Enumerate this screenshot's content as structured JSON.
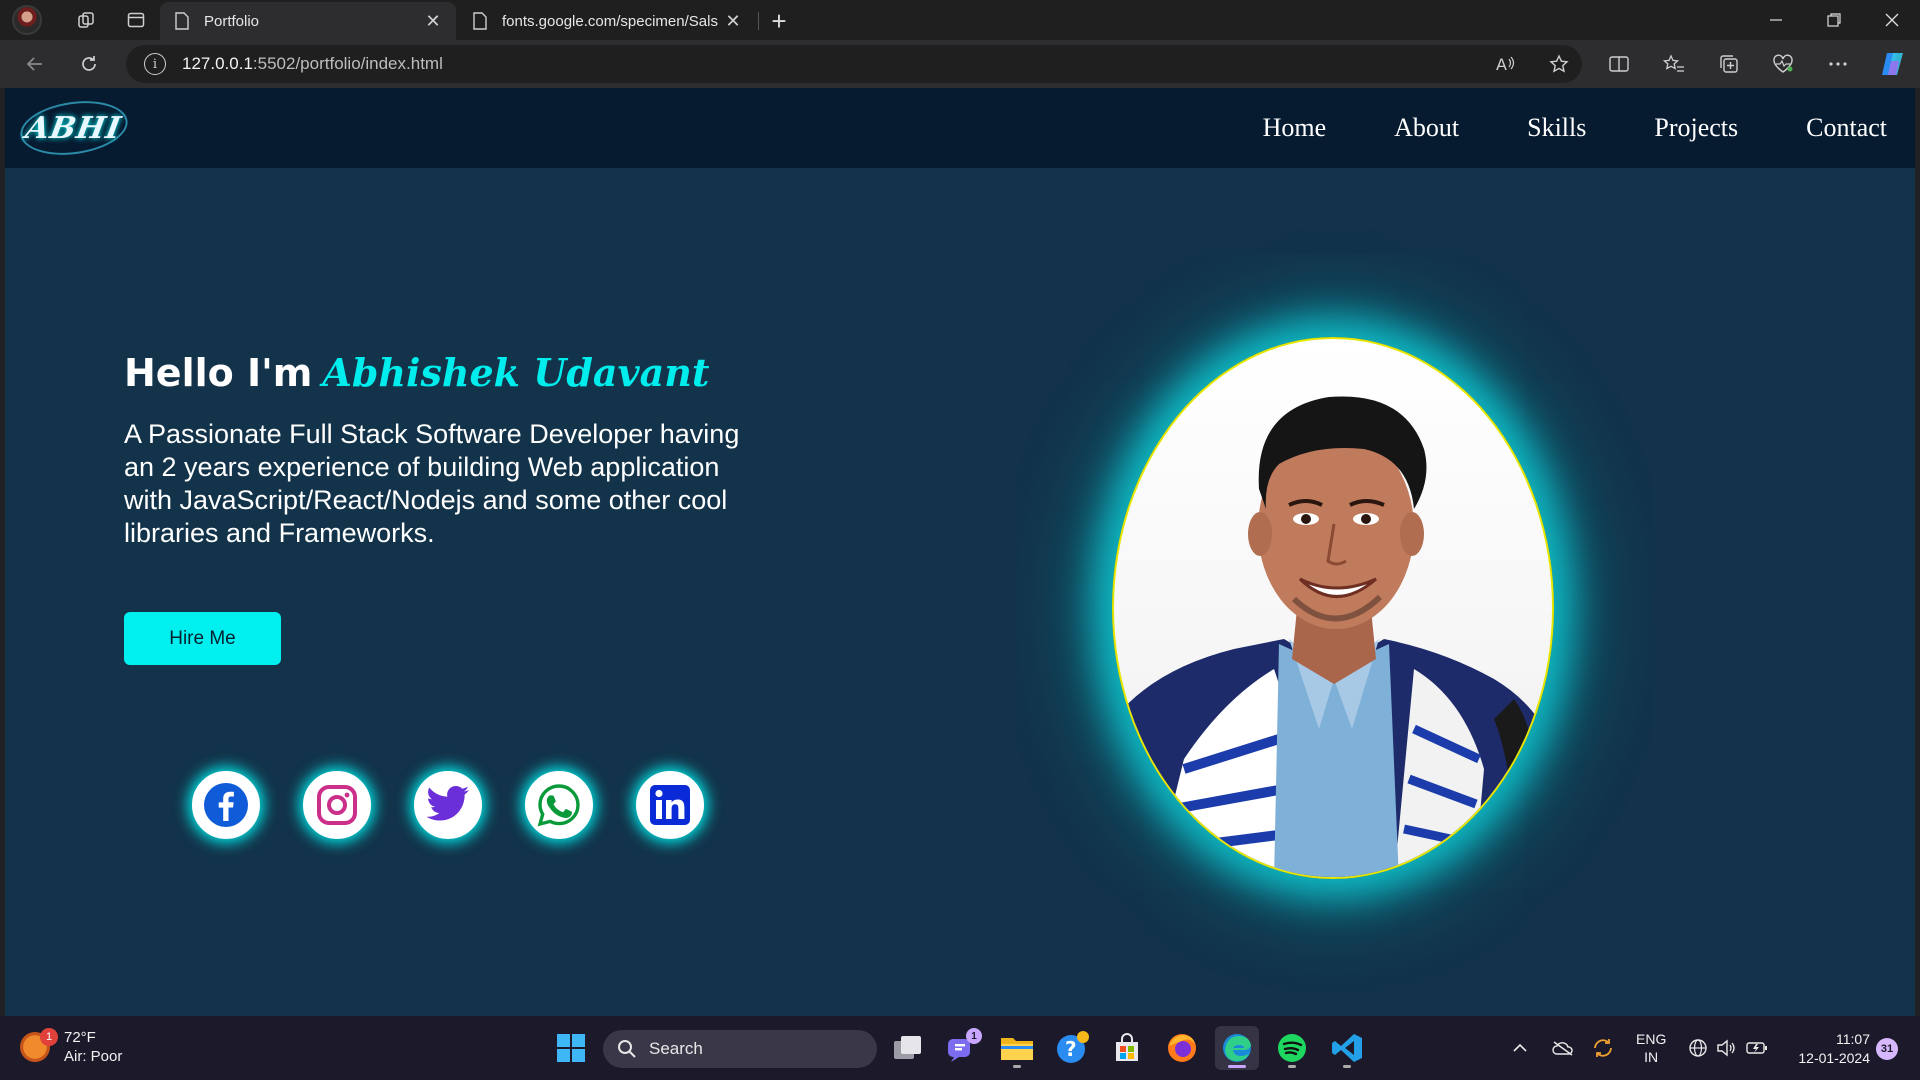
{
  "browser": {
    "tabs": [
      {
        "title": "Portfolio",
        "active": true
      },
      {
        "title": "fonts.google.com/specimen/Sals",
        "active": false
      }
    ],
    "address": {
      "host": "127.0.0.1",
      "rest": ":5502/portfolio/index.html"
    }
  },
  "page": {
    "logo_text": "ABHI",
    "nav": [
      "Home",
      "About",
      "Skills",
      "Projects",
      "Contact"
    ],
    "hero": {
      "greeting": "Hello I'm",
      "name": "Abhishek Udavant",
      "description": "A Passionate Full Stack Software Developer having an 2 years experience of building Web application with JavaScript/React/Nodejs and some other cool libraries and Frameworks.",
      "cta": "Hire Me"
    },
    "socials": [
      "facebook-icon",
      "instagram-icon",
      "twitter-icon",
      "whatsapp-icon",
      "linkedin-icon"
    ],
    "colors": {
      "accent": "#00eded",
      "background": "#12334a",
      "navbar": "#061a30",
      "photo_border": "#e6e600"
    }
  },
  "taskbar": {
    "weather": {
      "temp": "72°F",
      "condition": "Air: Poor",
      "badge": "1"
    },
    "search_label": "Search",
    "teams_badge": "1",
    "language": {
      "lang": "ENG",
      "region": "IN"
    },
    "clock": {
      "time": "11:07",
      "date": "12-01-2024"
    },
    "notification_count": "31"
  }
}
